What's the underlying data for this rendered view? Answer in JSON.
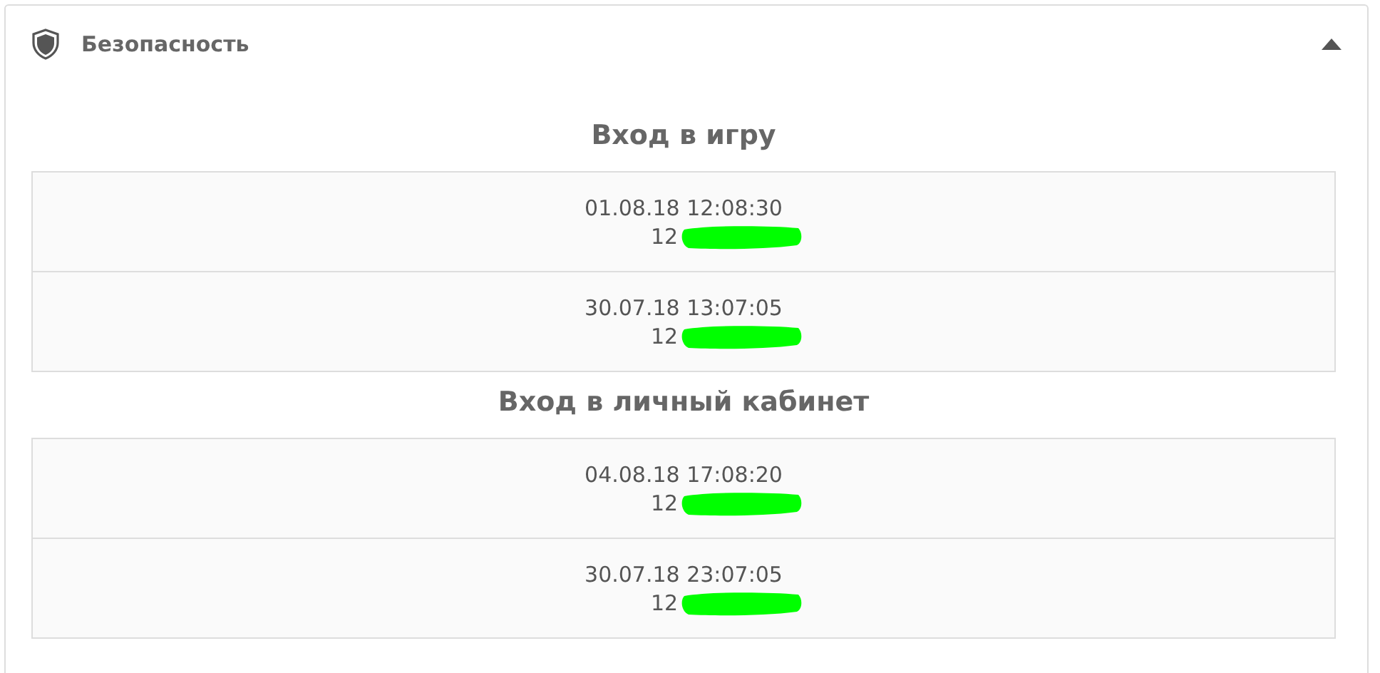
{
  "panel": {
    "title": "Безопасность",
    "expanded": true
  },
  "sections": [
    {
      "heading": "Вход в игру",
      "rows": [
        {
          "time": "01.08.18 12:08:30",
          "ip": "12"
        },
        {
          "time": "30.07.18 13:07:05",
          "ip": "12"
        }
      ]
    },
    {
      "heading": "Вход в личный кабинет",
      "rows": [
        {
          "time": "04.08.18 17:08:20",
          "ip": "12"
        },
        {
          "time": "30.07.18 23:07:05",
          "ip": "12"
        }
      ]
    }
  ]
}
